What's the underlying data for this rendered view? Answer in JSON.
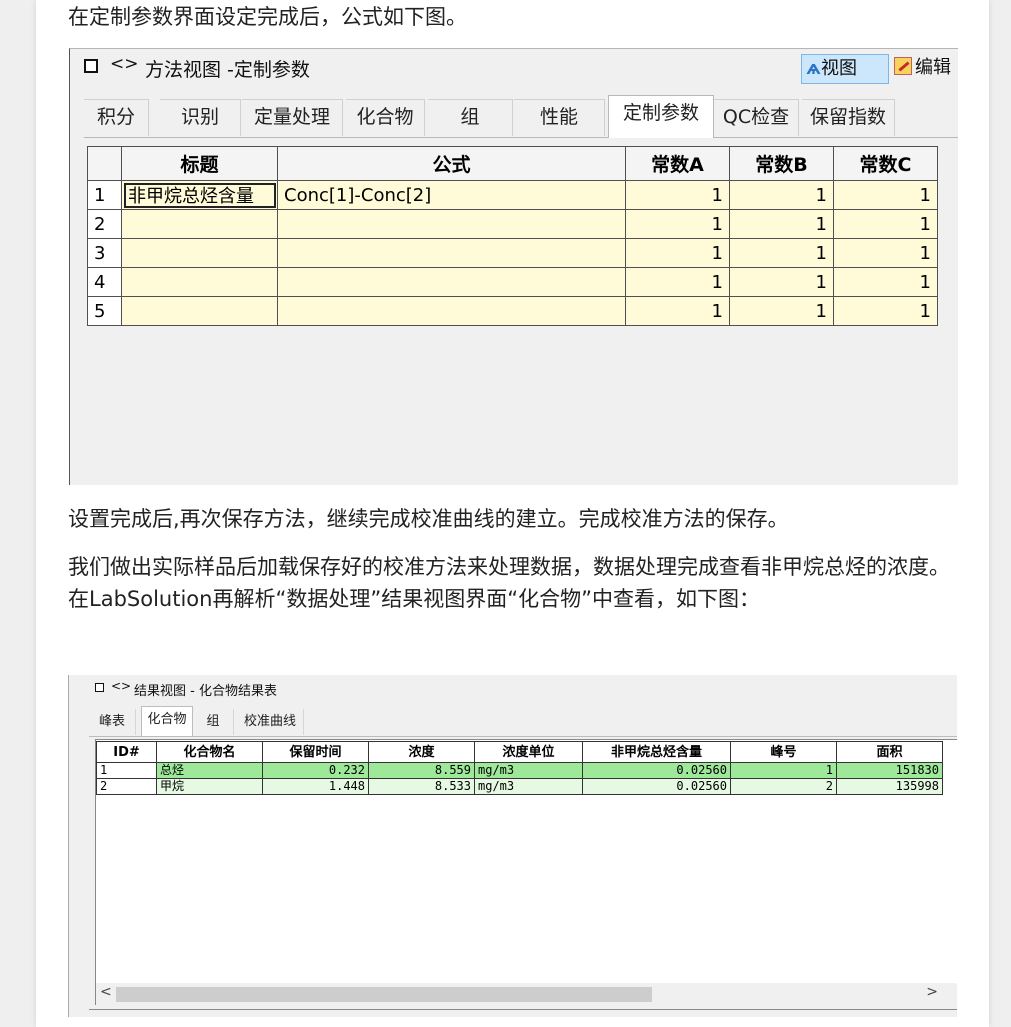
{
  "paragraphs": {
    "p1": "在定制参数界面设定完成后，公式如下图。",
    "p2": "设置完成后,再次保存方法，继续完成校准曲线的建立。完成校准方法的保存。",
    "p3": "我们做出实际样品后加载保存好的校准方法来处理数据，数据处理完成查看非甲烷总烃的浓度。在LabSolution再解析“数据处理”结果视图界面“化合物”中查看，如下图："
  },
  "shot1": {
    "title_arrows": "<>",
    "title": "方法视图 -定制参数",
    "view_button": "视图",
    "edit_button": "编辑",
    "tabs": [
      "积分",
      "识别",
      "定量处理",
      "化合物",
      "组",
      "性能",
      "定制参数",
      "QC检查",
      "保留指数"
    ],
    "active_tab": "定制参数",
    "columns": [
      "",
      "标题",
      "公式",
      "常数A",
      "常数B",
      "常数C"
    ],
    "rows": [
      {
        "n": "1",
        "title": "非甲烷总烃含量",
        "formula": "Conc[1]-Conc[2]",
        "a": "1",
        "b": "1",
        "c": "1"
      },
      {
        "n": "2",
        "title": "",
        "formula": "",
        "a": "1",
        "b": "1",
        "c": "1"
      },
      {
        "n": "3",
        "title": "",
        "formula": "",
        "a": "1",
        "b": "1",
        "c": "1"
      },
      {
        "n": "4",
        "title": "",
        "formula": "",
        "a": "1",
        "b": "1",
        "c": "1"
      },
      {
        "n": "5",
        "title": "",
        "formula": "",
        "a": "1",
        "b": "1",
        "c": "1"
      }
    ]
  },
  "shot2": {
    "title_arrows": "<>",
    "title": "结果视图 -  化合物结果表",
    "tabs": [
      "峰表",
      "化合物",
      "组",
      "校准曲线"
    ],
    "active_tab": "化合物",
    "columns": [
      "ID#",
      "化合物名",
      "保留时间",
      "浓度",
      "浓度单位",
      "非甲烷总烃含量",
      "峰号",
      "面积"
    ],
    "rows": [
      {
        "id": "1",
        "name": "总烃",
        "rt": "0.232",
        "conc": "8.559",
        "unit": "mg/m3",
        "nmhc": "0.02560",
        "peak": "1",
        "area": "151830"
      },
      {
        "id": "2",
        "name": "甲烷",
        "rt": "1.448",
        "conc": "8.533",
        "unit": "mg/m3",
        "nmhc": "0.02560",
        "peak": "2",
        "area": "135998"
      }
    ],
    "scroll_left": "<",
    "scroll_right": ">"
  }
}
